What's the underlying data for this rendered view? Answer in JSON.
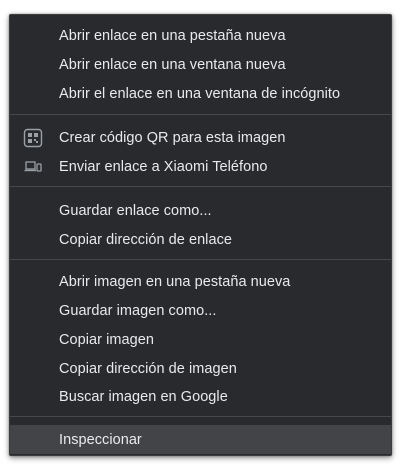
{
  "menu": {
    "groups": [
      {
        "items": [
          {
            "label": "Abrir enlace en una pestaña nueva"
          },
          {
            "label": "Abrir enlace en una ventana nueva"
          },
          {
            "label": "Abrir el enlace en una ventana de incógnito"
          }
        ]
      },
      {
        "items": [
          {
            "label": "Crear código QR para esta imagen",
            "icon": "qr-code-icon"
          },
          {
            "label": "Enviar enlace a Xiaomi Teléfono",
            "icon": "devices-icon"
          }
        ]
      },
      {
        "items": [
          {
            "label": "Guardar enlace como..."
          },
          {
            "label": "Copiar dirección de enlace"
          }
        ]
      },
      {
        "items": [
          {
            "label": "Abrir imagen en una pestaña nueva"
          },
          {
            "label": "Guardar imagen como..."
          },
          {
            "label": "Copiar imagen"
          },
          {
            "label": "Copiar dirección de imagen"
          },
          {
            "label": "Buscar imagen en Google"
          }
        ]
      },
      {
        "items": [
          {
            "label": "Inspeccionar",
            "highlighted": true
          }
        ]
      }
    ]
  },
  "colors": {
    "menu_background": "#292a2d",
    "text": "#e8eaed",
    "separator": "#45474a",
    "highlight": "#434447",
    "icon": "#9aa0a6"
  }
}
